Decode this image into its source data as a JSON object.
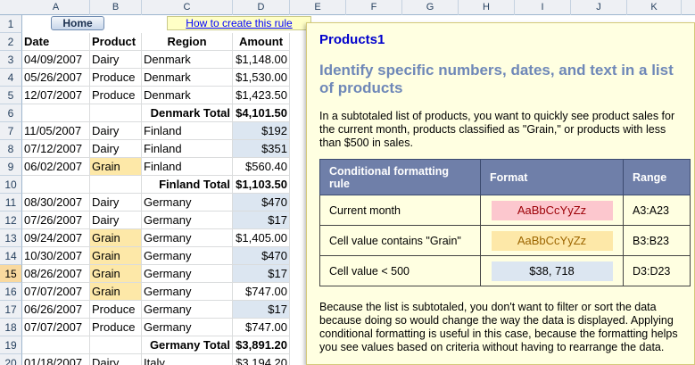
{
  "columns": [
    "A",
    "B",
    "C",
    "D",
    "E",
    "F",
    "G",
    "H",
    "I",
    "J",
    "K"
  ],
  "row_numbers": [
    1,
    2,
    3,
    4,
    5,
    6,
    7,
    8,
    9,
    10,
    11,
    12,
    13,
    14,
    15,
    16,
    17,
    18,
    19,
    20
  ],
  "selected_row": 15,
  "home_button": "Home",
  "how_link": "How to create this rule",
  "headers": {
    "date": "Date",
    "product": "Product",
    "region": "Region",
    "amount": "Amount"
  },
  "rows": [
    {
      "date": "04/09/2007",
      "product": "Dairy",
      "region": "Denmark",
      "amount": "$1,148.00",
      "grain": false,
      "low": false
    },
    {
      "date": "05/26/2007",
      "product": "Produce",
      "region": "Denmark",
      "amount": "$1,530.00",
      "grain": false,
      "low": false
    },
    {
      "date": "12/07/2007",
      "product": "Produce",
      "region": "Denmark",
      "amount": "$1,423.50",
      "grain": false,
      "low": false
    },
    {
      "date": "",
      "product": "",
      "region": "Denmark Total",
      "amount": "$4,101.50",
      "total": true
    },
    {
      "date": "11/05/2007",
      "product": "Dairy",
      "region": "Finland",
      "amount": "$192",
      "grain": false,
      "low": true
    },
    {
      "date": "07/12/2007",
      "product": "Dairy",
      "region": "Finland",
      "amount": "$351",
      "grain": false,
      "low": true
    },
    {
      "date": "06/02/2007",
      "product": "Grain",
      "region": "Finland",
      "amount": "$560.40",
      "grain": true,
      "low": false
    },
    {
      "date": "",
      "product": "",
      "region": "Finland Total",
      "amount": "$1,103.50",
      "total": true
    },
    {
      "date": "08/30/2007",
      "product": "Dairy",
      "region": "Germany",
      "amount": "$470",
      "grain": false,
      "low": true
    },
    {
      "date": "07/26/2007",
      "product": "Dairy",
      "region": "Germany",
      "amount": "$17",
      "grain": false,
      "low": true
    },
    {
      "date": "09/24/2007",
      "product": "Grain",
      "region": "Germany",
      "amount": "$1,405.00",
      "grain": true,
      "low": false
    },
    {
      "date": "10/30/2007",
      "product": "Grain",
      "region": "Germany",
      "amount": "$470",
      "grain": true,
      "low": true
    },
    {
      "date": "08/26/2007",
      "product": "Grain",
      "region": "Germany",
      "amount": "$17",
      "grain": true,
      "low": true
    },
    {
      "date": "07/07/2007",
      "product": "Grain",
      "region": "Germany",
      "amount": "$747.00",
      "grain": true,
      "low": false
    },
    {
      "date": "06/26/2007",
      "product": "Produce",
      "region": "Germany",
      "amount": "$17",
      "grain": false,
      "low": true
    },
    {
      "date": "07/07/2007",
      "product": "Produce",
      "region": "Germany",
      "amount": "$747.00",
      "grain": false,
      "low": false
    },
    {
      "date": "",
      "product": "",
      "region": "Germany Total",
      "amount": "$3,891.20",
      "total": true
    },
    {
      "date": "01/18/2007",
      "product": "Dairy",
      "region": "Italy",
      "amount": "$3,194.20",
      "grain": false,
      "low": false
    }
  ],
  "note": {
    "title": "Products1",
    "heading": "Identify specific numbers, dates, and text in a list of products",
    "intro": "In a subtotaled list of products, you want to quickly see product sales for the current  month, products classified as \"Grain,\" or products with less than $500  in sales.",
    "table_headers": [
      "Conditional formatting rule",
      "Format",
      "Range"
    ],
    "rules": [
      {
        "rule": "Current month",
        "swatch": "AaBbCcYyZz",
        "range": "A3:A23"
      },
      {
        "rule": "Cell value contains \"Grain\"",
        "swatch": "AaBbCcYyZz",
        "range": "B3:B23"
      },
      {
        "rule": "Cell value < 500",
        "swatch": "$38, 718",
        "range": "D3:D23"
      }
    ],
    "footer": "Because the list is subtotaled, you don't want to filter or sort the data because doing so would change the way the data is displayed. Applying conditional formatting is useful in this case, because the formatting helps you see values based on criteria without having to rearrange the data."
  }
}
